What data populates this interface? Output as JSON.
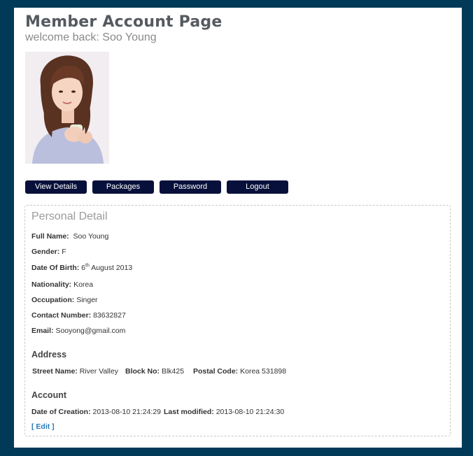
{
  "header": {
    "title": "Member Account Page",
    "welcome": "welcome back: Soo Young"
  },
  "nav": {
    "view_details": "View Details",
    "packages": "Packages",
    "password": "Password",
    "logout": "Logout"
  },
  "personal": {
    "heading": "Personal Detail",
    "full_name_label": "Full Name:",
    "full_name": "Soo Young",
    "gender_label": "Gender:",
    "gender": "F",
    "dob_label": "Date Of Birth:",
    "dob_day": "6",
    "dob_suffix": "th",
    "dob_rest": "August 2013",
    "nationality_label": "Nationality:",
    "nationality": "Korea",
    "occupation_label": "Occupation:",
    "occupation": "Singer",
    "contact_label": "Contact Number:",
    "contact": "83632827",
    "email_label": "Email:",
    "email": "Sooyong@gmail.com"
  },
  "address": {
    "heading": "Address",
    "street_label": "Street Name:",
    "street": "River Valley",
    "block_label": "Block No:",
    "block": "Blk425",
    "postal_label": "Postal Code:",
    "postal": "Korea 531898"
  },
  "account": {
    "heading": "Account",
    "created_label": "Date of Creation:",
    "created": "2013-08-10 21:24:29",
    "modified_label": "Last modified:",
    "modified": "2013-08-10 21:24:30",
    "edit_link": "[ Edit ]"
  },
  "colors": {
    "frame": "#003a58",
    "button": "#07103a",
    "link": "#2a7ab8"
  }
}
